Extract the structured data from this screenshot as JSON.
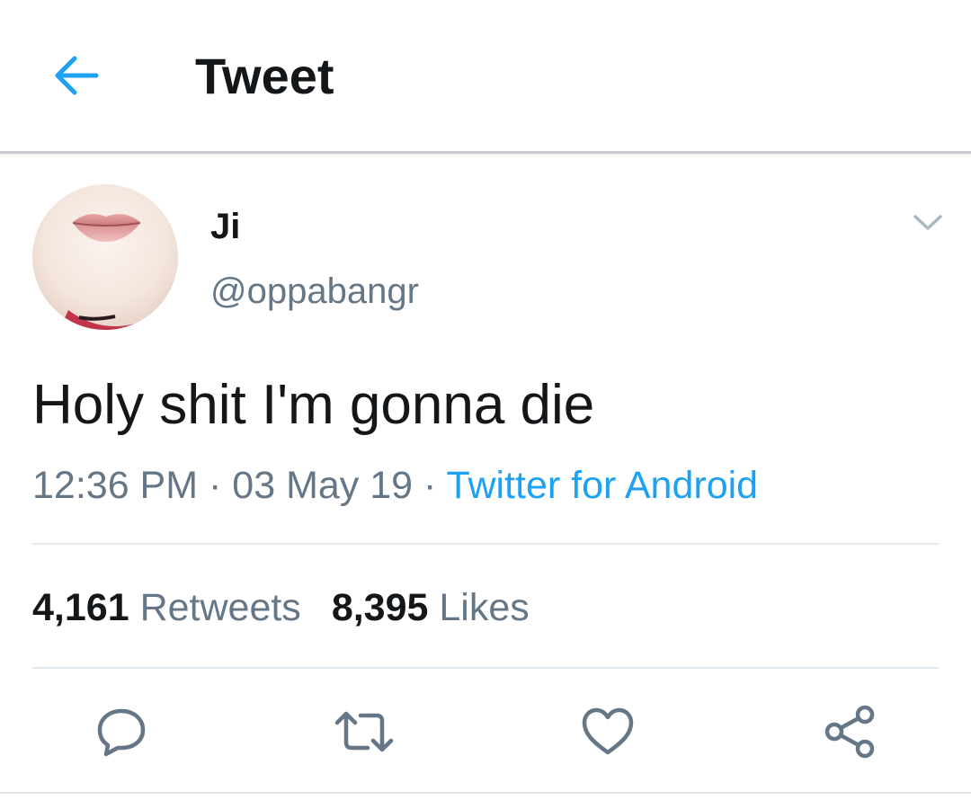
{
  "header": {
    "title": "Tweet",
    "back_icon": "arrow-left-icon"
  },
  "tweet": {
    "display_name": "Ji",
    "handle": "@oppabangr",
    "text": "Holy shit I'm gonna die",
    "time": "12:36 PM",
    "date": "03 May 19",
    "separator": "·",
    "source": "Twitter for Android",
    "retweets_count": "4,161",
    "retweets_label": "Retweets",
    "likes_count": "8,395",
    "likes_label": "Likes"
  },
  "actions": [
    {
      "icon": "reply-icon"
    },
    {
      "icon": "retweet-icon"
    },
    {
      "icon": "like-icon"
    },
    {
      "icon": "share-icon"
    }
  ],
  "colors": {
    "accent": "#1da1f2",
    "text_primary": "#14171a",
    "text_secondary": "#657786",
    "icon_gray": "#657786",
    "divider": "#e1e8ed"
  }
}
